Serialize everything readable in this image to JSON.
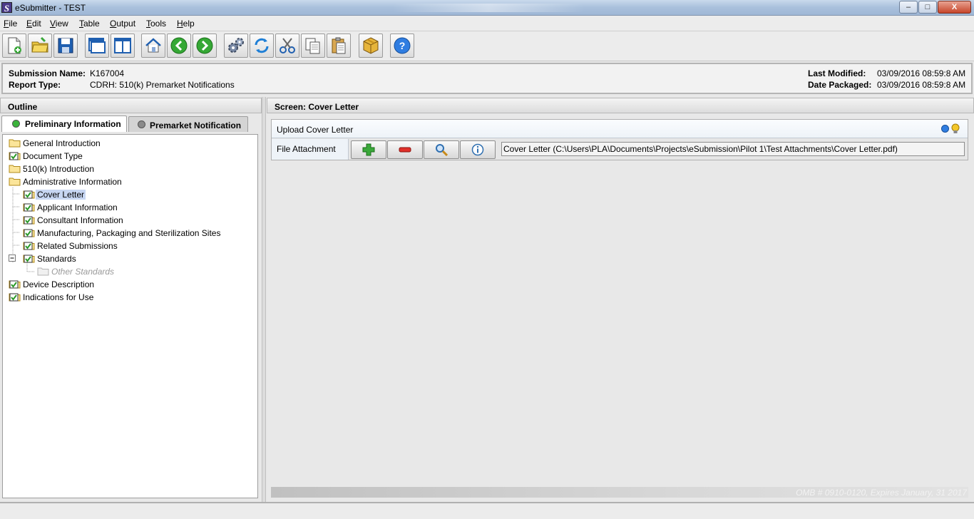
{
  "window": {
    "title": "eSubmitter - TEST",
    "app_icon_letter": "S",
    "controls": {
      "minimize": "–",
      "maximize": "□",
      "close": "X"
    }
  },
  "menu": [
    {
      "label": "File",
      "hotkey": "F",
      "rest": "ile"
    },
    {
      "label": "Edit",
      "hotkey": "E",
      "rest": "dit"
    },
    {
      "label": "View",
      "hotkey": "V",
      "rest": "iew"
    },
    {
      "label": "Table",
      "hotkey": "T",
      "rest": "able"
    },
    {
      "label": "Output",
      "hotkey": "O",
      "rest": "utput"
    },
    {
      "label": "Tools",
      "hotkey": "T",
      "rest": "ools"
    },
    {
      "label": "Help",
      "hotkey": "H",
      "rest": "elp"
    }
  ],
  "toolbar": {
    "icons": [
      "new-document-icon",
      "open-folder-icon",
      "save-icon",
      "window-icon",
      "split-view-icon",
      "home-icon",
      "back-arrow-icon",
      "forward-arrow-icon",
      "settings-gears-icon",
      "refresh-icon",
      "cut-icon",
      "copy-icon",
      "paste-icon",
      "package-icon",
      "help-icon"
    ]
  },
  "submission": {
    "name_label": "Submission Name:",
    "name_value": "K167004",
    "type_label": "Report Type:",
    "type_value": "CDRH: 510(k) Premarket Notifications",
    "modified_label": "Last Modified:",
    "modified_value": "03/09/2016 08:59:8 AM",
    "packaged_label": "Date Packaged:",
    "packaged_value": "03/09/2016 08:59:8 AM"
  },
  "outline": {
    "header": "Outline",
    "tabs": [
      {
        "label": "Preliminary Information",
        "active": true,
        "dot_color": "#3bb33b"
      },
      {
        "label": "Premarket Notification",
        "active": false,
        "dot_color": "#8a8a8a"
      }
    ],
    "tree": [
      {
        "label": "General Introduction",
        "level": 0,
        "icon": "folder-icon",
        "checked": false
      },
      {
        "label": "Document Type",
        "level": 0,
        "icon": "folder-check-icon",
        "checked": true
      },
      {
        "label": "510(k) Introduction",
        "level": 0,
        "icon": "folder-icon",
        "checked": false
      },
      {
        "label": "Administrative Information",
        "level": 0,
        "icon": "folder-icon",
        "checked": false
      },
      {
        "label": "Cover Letter",
        "level": 1,
        "icon": "folder-check-icon",
        "checked": true,
        "selected": true
      },
      {
        "label": "Applicant Information",
        "level": 1,
        "icon": "folder-check-icon",
        "checked": true
      },
      {
        "label": "Consultant Information",
        "level": 1,
        "icon": "folder-check-icon",
        "checked": true
      },
      {
        "label": "Manufacturing, Packaging and Sterilization Sites",
        "level": 1,
        "icon": "folder-check-icon",
        "checked": true
      },
      {
        "label": "Related Submissions",
        "level": 1,
        "icon": "folder-check-icon",
        "checked": true
      },
      {
        "label": "Standards",
        "level": 1,
        "icon": "folder-check-icon",
        "checked": true,
        "expanded": true
      },
      {
        "label": "Other Standards",
        "level": 2,
        "icon": "folder-disabled-icon",
        "disabled": true
      },
      {
        "label": "Device Description",
        "level": 0,
        "icon": "folder-check-icon",
        "checked": true
      },
      {
        "label": "Indications for Use",
        "level": 0,
        "icon": "folder-check-icon",
        "checked": true
      }
    ]
  },
  "screen": {
    "header": "Screen: Cover Letter",
    "section_title": "Upload Cover Letter",
    "attachment_label": "File Attachment",
    "attachment_buttons": [
      "add-icon",
      "remove-icon",
      "view-icon",
      "info-icon"
    ],
    "file_value": "Cover Letter (C:\\Users\\PLA\\Documents\\Projects\\eSubmission\\Pilot 1\\Test Attachments\\Cover Letter.pdf)",
    "indicator_colors": {
      "blue": "#2f7de1",
      "bulb": "#f3c72a"
    }
  },
  "footer": {
    "omb": "OMB # 0910-0120, Expires January, 31 2017"
  }
}
